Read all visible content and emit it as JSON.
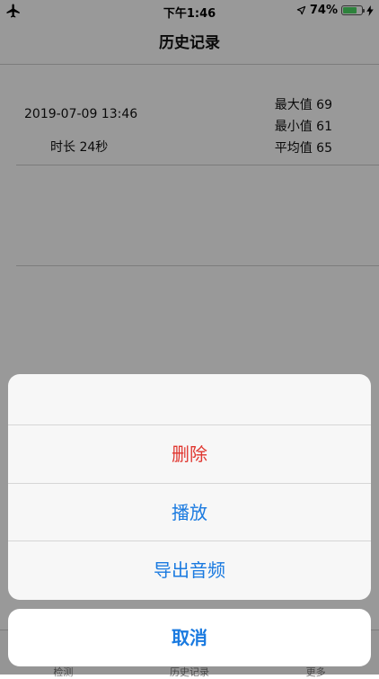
{
  "status_bar": {
    "time": "下午1:46",
    "battery_percent": "74%",
    "battery_level": 74
  },
  "nav": {
    "title": "历史记录"
  },
  "records": [
    {
      "date": "2019-07-09 13:46",
      "duration": "时长 24秒",
      "max": "最大值 69",
      "min": "最小值 61",
      "avg": "平均值 65"
    }
  ],
  "tabs": [
    {
      "label": "检测"
    },
    {
      "label": "历史记录"
    },
    {
      "label": "更多"
    }
  ],
  "action_sheet": {
    "items": [
      {
        "label": "删除",
        "style": "destructive"
      },
      {
        "label": "播放"
      },
      {
        "label": "导出音频"
      }
    ],
    "cancel": "取消"
  },
  "colors": {
    "destructive": "#e0362f",
    "action": "#1a7ae0",
    "battery": "#4cd964"
  },
  "icons": [
    "airplane-icon",
    "location-arrow-icon",
    "battery-icon",
    "charging-bolt-icon"
  ]
}
